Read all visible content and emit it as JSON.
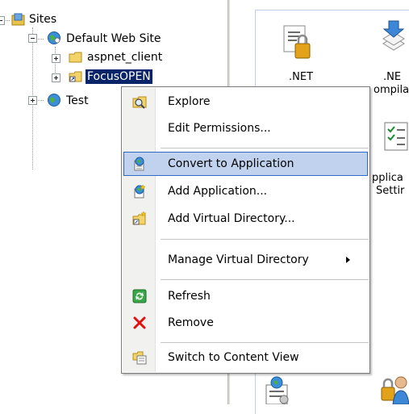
{
  "tree": {
    "sites": "Sites",
    "default_site": "Default Web Site",
    "aspnet_client": "aspnet_client",
    "focusopen": "FocusOPEN",
    "test": "Test"
  },
  "features": {
    "net_label_1": ".NET",
    "net_label_2": ".NE",
    "compilation_partial": "ompila",
    "applica_partial": "pplica",
    "settings_partial": "Settir"
  },
  "context_menu": {
    "items": [
      {
        "label": "Explore",
        "icon": "explore-icon"
      },
      {
        "label": "Edit Permissions...",
        "icon": "none"
      },
      {
        "label": "Convert to Application",
        "icon": "convert-app-icon"
      },
      {
        "label": "Add Application...",
        "icon": "add-app-icon"
      },
      {
        "label": "Add Virtual Directory...",
        "icon": "add-vdir-icon"
      },
      {
        "label": "Manage Virtual Directory",
        "icon": "none",
        "submenu": true
      },
      {
        "label": "Refresh",
        "icon": "refresh-icon"
      },
      {
        "label": "Remove",
        "icon": "remove-icon"
      },
      {
        "label": "Switch to Content View",
        "icon": "content-view-icon"
      }
    ],
    "highlighted": "Convert to Application"
  },
  "colors": {
    "selection": "#0a246a",
    "menu_highlight": "#c1d2ee",
    "menu_highlight_border": "#316ac5",
    "remove_red": "#e01010"
  }
}
